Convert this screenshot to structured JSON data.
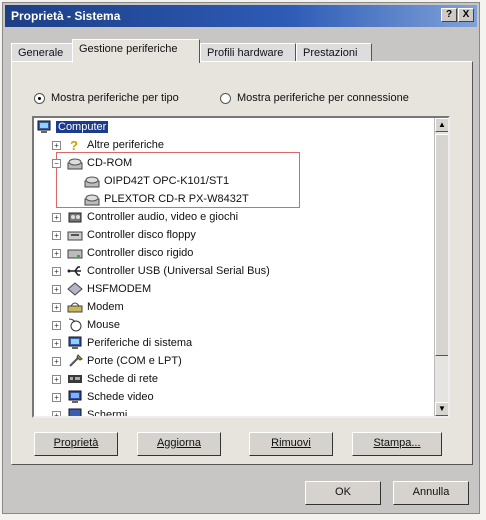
{
  "window": {
    "title": "Proprietà - Sistema",
    "help_btn": "?",
    "close_btn": "X"
  },
  "tabs": [
    {
      "label": "Generale"
    },
    {
      "label": "Gestione periferiche"
    },
    {
      "label": "Profili hardware"
    },
    {
      "label": "Prestazioni"
    }
  ],
  "view_options": {
    "by_type": "Mostra periferiche per tipo",
    "by_connection": "Mostra periferiche per connessione"
  },
  "tree": {
    "root": "Computer",
    "items": [
      {
        "label": "Altre periferiche",
        "expand": "+",
        "icon": "question-icon"
      },
      {
        "label": "CD-ROM",
        "expand": "−",
        "icon": "cdrom-icon"
      },
      {
        "label": "OIPD42T OPC-K101/ST1",
        "icon": "cdrom-icon"
      },
      {
        "label": "PLEXTOR CD-R   PX-W8432T",
        "icon": "cdrom-icon"
      },
      {
        "label": "Controller audio, video e giochi",
        "expand": "+",
        "icon": "audio-icon"
      },
      {
        "label": "Controller disco floppy",
        "expand": "+",
        "icon": "floppy-icon"
      },
      {
        "label": "Controller disco rigido",
        "expand": "+",
        "icon": "harddisk-icon"
      },
      {
        "label": "Controller USB (Universal Serial Bus)",
        "expand": "+",
        "icon": "usb-icon"
      },
      {
        "label": "HSFMODEM",
        "expand": "+",
        "icon": "modem-diamond-icon"
      },
      {
        "label": "Modem",
        "expand": "+",
        "icon": "modem-icon"
      },
      {
        "label": "Mouse",
        "expand": "+",
        "icon": "mouse-icon"
      },
      {
        "label": "Periferiche di sistema",
        "expand": "+",
        "icon": "computer-icon"
      },
      {
        "label": "Porte (COM e LPT)",
        "expand": "+",
        "icon": "port-icon"
      },
      {
        "label": "Schede di rete",
        "expand": "+",
        "icon": "network-icon"
      },
      {
        "label": "Schede video",
        "expand": "+",
        "icon": "display-icon"
      },
      {
        "label": "Schermi",
        "expand": "+",
        "icon": "monitor-icon"
      }
    ]
  },
  "buttons": {
    "properties": "Proprietà",
    "refresh": "Aggiorna",
    "remove": "Rimuovi",
    "print": "Stampa...",
    "ok": "OK",
    "cancel": "Annulla"
  }
}
